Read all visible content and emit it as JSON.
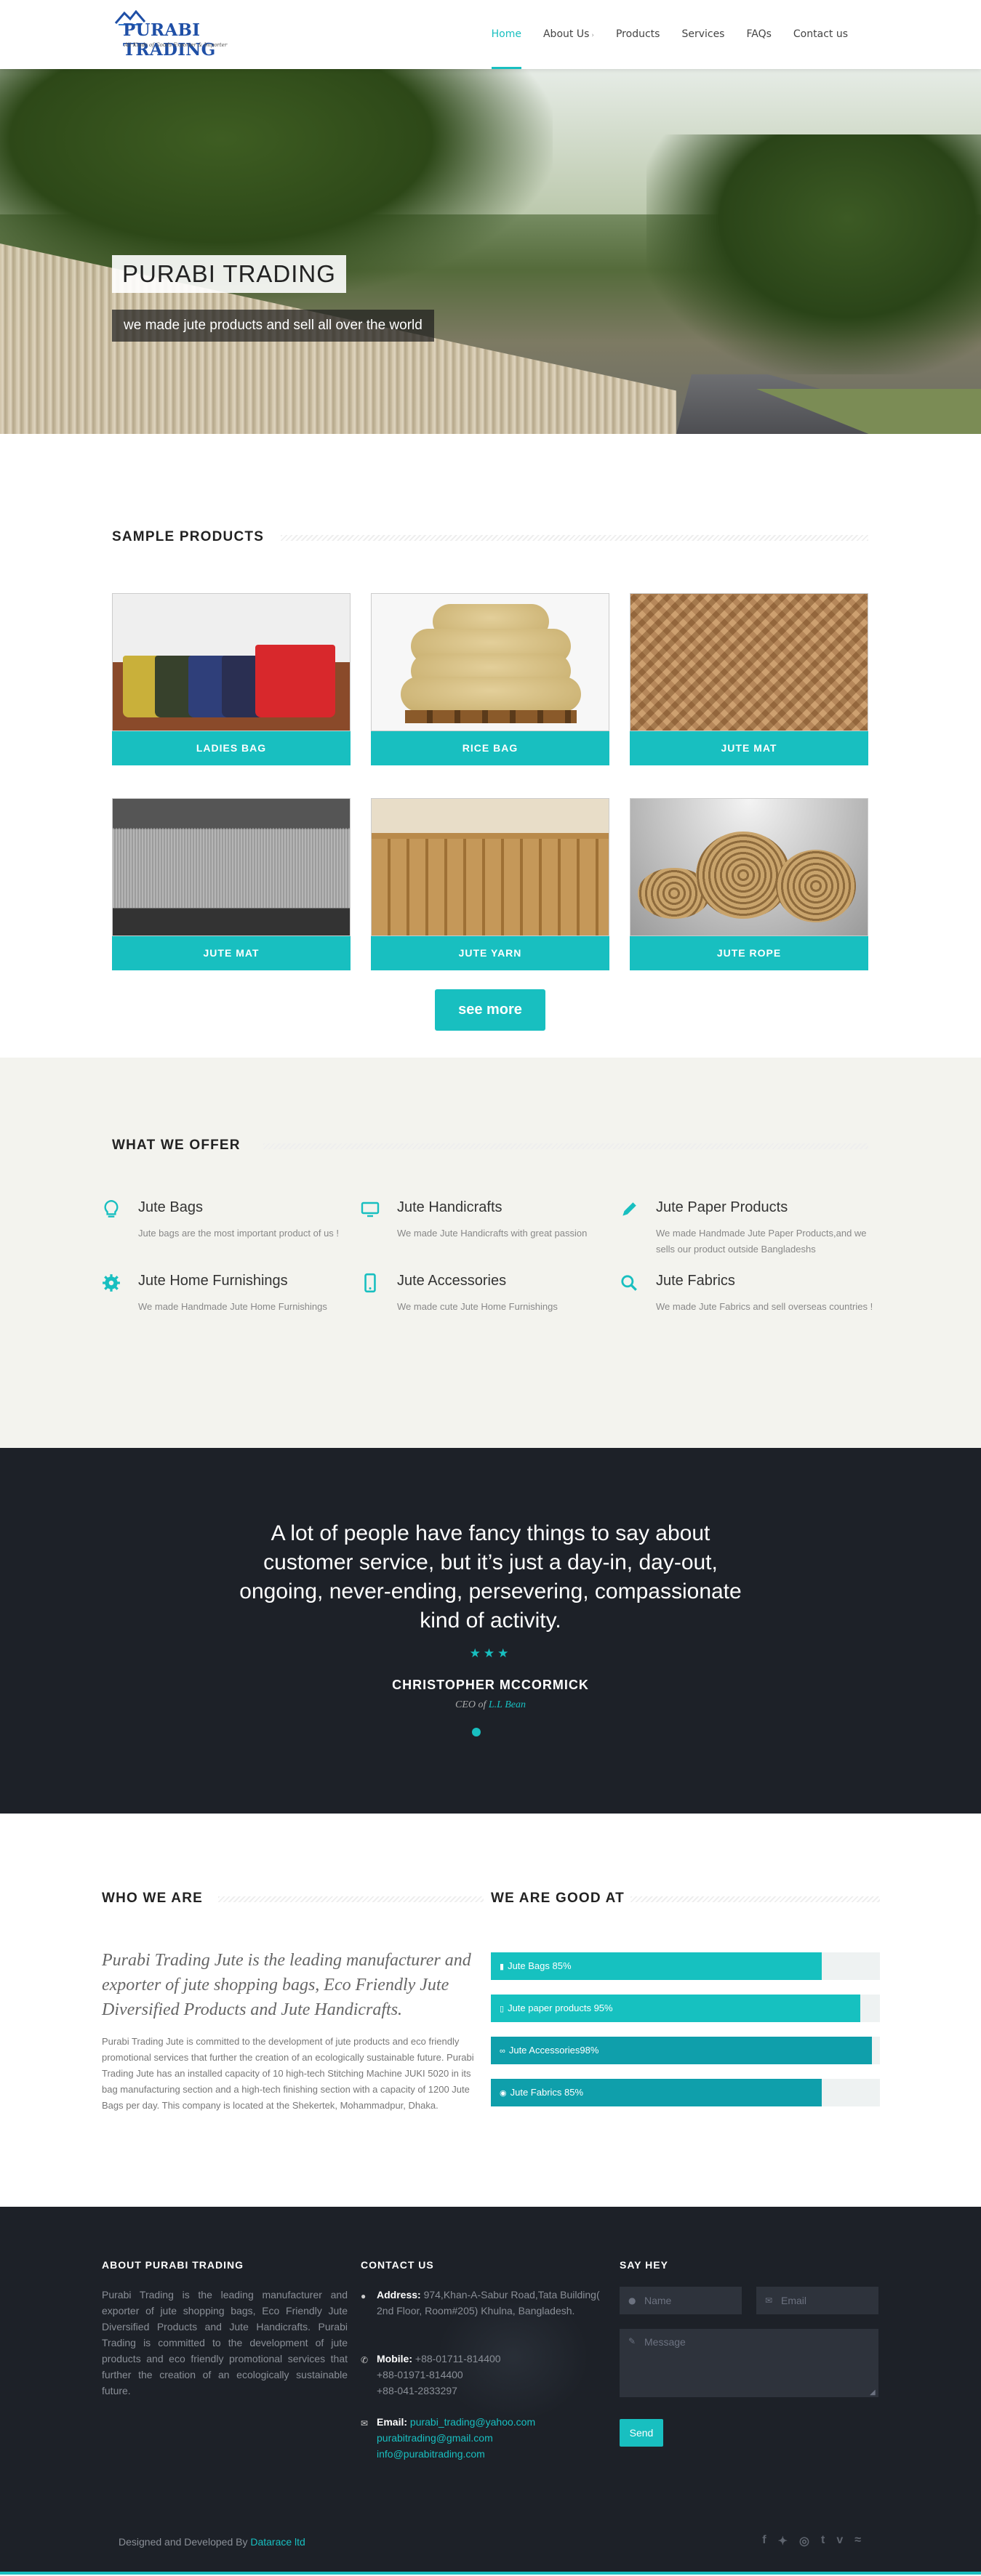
{
  "header": {
    "logo_text": "PURABI TRADING",
    "logo_tagline": "All Kinds of Goods Exporter & Importer",
    "nav": [
      {
        "label": "Home"
      },
      {
        "label": "About Us"
      },
      {
        "label": "Products"
      },
      {
        "label": "Services"
      },
      {
        "label": "FAQs"
      },
      {
        "label": "Contact us"
      }
    ],
    "active": "Home"
  },
  "hero": {
    "title": "PURABI TRADING",
    "subtitle": "we made jute products and sell all over the world"
  },
  "products": {
    "heading": "SAMPLE PRODUCTS",
    "items": [
      {
        "label": "LADIES BAG"
      },
      {
        "label": "RICE BAG"
      },
      {
        "label": "JUTE MAT"
      },
      {
        "label": "JUTE MAT"
      },
      {
        "label": "JUTE YARN"
      },
      {
        "label": "JUTE ROPE"
      }
    ],
    "see_more": "see more"
  },
  "offer": {
    "heading": "WHAT WE OFFER",
    "items": [
      {
        "title": "Jute Bags",
        "desc": "Jute bags are the most important product of us !",
        "icon": "lightbulb-icon"
      },
      {
        "title": "Jute Handicrafts",
        "desc": "We made Jute Handicrafts with great passion",
        "icon": "monitor-icon"
      },
      {
        "title": "Jute Paper Products",
        "desc": "We made Handmade Jute Paper Products,and we sells our product outside Bangladeshs",
        "icon": "pencil-icon"
      },
      {
        "title": "Jute Home Furnishings",
        "desc": "We made Handmade Jute Home Furnishings",
        "icon": "gear-icon"
      },
      {
        "title": "Jute Accessories",
        "desc": "We made cute Jute Home Furnishings",
        "icon": "mobile-icon"
      },
      {
        "title": "Jute Fabrics",
        "desc": "We made Jute Fabrics and sell overseas countries !",
        "icon": "search-icon"
      }
    ]
  },
  "testimonial": {
    "quote": "A lot of people have fancy things to say about customer service, but it’s just a day-in, day-out, ongoing, never-ending, persevering, compassionate kind of activity.",
    "stars": "★★★",
    "author": "CHRISTOPHER MCCORMICK",
    "role_prefix": "CEO of",
    "company": "L.L Bean"
  },
  "who": {
    "heading": "WHO WE ARE",
    "lead": "Purabi Trading Jute is the leading manufacturer and exporter of jute shopping bags, Eco Friendly Jute Diversified Products and Jute Handicrafts.",
    "body": "Purabi Trading Jute is committed to the development of jute products and eco friendly promotional services that further the creation of an ecologically sustainable future. Purabi Trading Jute has an installed capacity of 10 high-tech Stitching Machine JUKI 5020 in its bag manufacturing section and a high-tech finishing section with a capacity of 1200 Jute Bags per day. This company is located at the Shekertek, Mohammadpur, Dhaka."
  },
  "skills": {
    "heading": "WE ARE GOOD AT",
    "bars": [
      {
        "label": "Jute Bags 85%",
        "value": 85,
        "color": "#16c1c0",
        "icon": "bookmark-icon"
      },
      {
        "label": "Jute paper products 95%",
        "value": 95,
        "color": "#16c1c0",
        "icon": "file-icon"
      },
      {
        "label": "Jute Accessories98%",
        "value": 98,
        "color": "#0f9fab",
        "icon": "link-icon"
      },
      {
        "label": "Jute Fabrics 85%",
        "value": 85,
        "color": "#0f9fab",
        "icon": "eye-icon"
      }
    ]
  },
  "footer": {
    "about_title": "ABOUT PURABI TRADING",
    "about_text": "Purabi Trading is the leading manufacturer and exporter of jute shopping bags, Eco Friendly Jute Diversified Products and Jute Handicrafts. Purabi Trading is committed to the development of jute products and eco friendly promotional services that further the creation of an ecologically sustainable future.",
    "contact_title": "CONTACT US",
    "address_label": "Address:",
    "address": "974,Khan-A-Sabur Road,Tata Building( 2nd Floor, Room#205) Khulna, Bangladesh.",
    "mobile_label": "Mobile:",
    "mobiles": [
      "+88-01711-814400",
      "+88-01971-814400",
      "+88-041-2833297"
    ],
    "email_label": "Email:",
    "emails": [
      "purabi_trading@yahoo.com",
      "purabitrading@gmail.com",
      "info@purabitrading.com"
    ],
    "sayhey_title": "SAY HEY",
    "name_placeholder": "Name",
    "email_placeholder": "Email",
    "message_placeholder": "Message",
    "send_label": "Send",
    "credit_prefix": "Designed and Developed By",
    "credit_link": "Datarace ltd",
    "social": [
      "facebook-icon",
      "twitter-icon",
      "dribbble-icon",
      "tumblr-icon",
      "vimeo-icon",
      "rss-icon"
    ]
  },
  "colors": {
    "accent": "#18bfc0",
    "dark": "#1d2128",
    "offer_bg": "#f3f3ee"
  }
}
